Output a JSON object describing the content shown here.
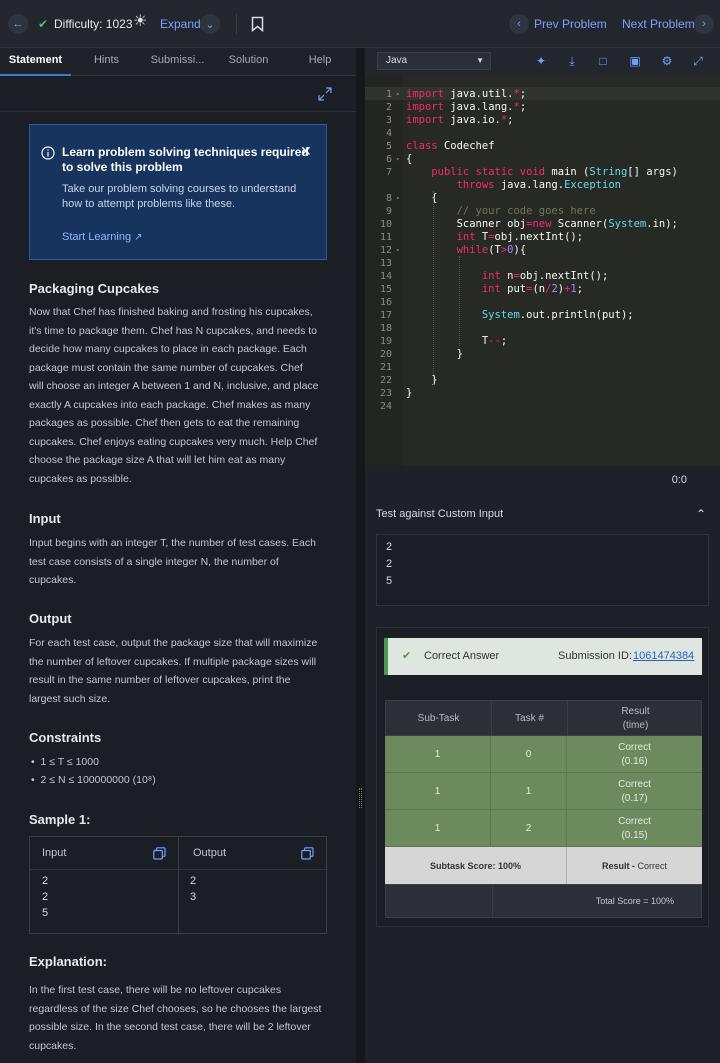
{
  "topbar": {
    "difficulty": "Difficulty: 1023",
    "expand": "Expand",
    "prev": "Prev Problem",
    "next": "Next Problem"
  },
  "tabs": [
    "Statement",
    "Hints",
    "Submissi...",
    "Solution",
    "Help"
  ],
  "callout": {
    "title": "Learn problem solving techniques required to solve this problem",
    "body": "Take our problem solving courses to understand how to attempt problems like these.",
    "link": "Start Learning"
  },
  "problem": {
    "title": "Packaging Cupcakes",
    "statement_lines": [
      "Now that Chef has finished baking and frosting his cupcakes,",
      "it's time to package them. Chef has N cupcakes, and needs to",
      "decide how many cupcakes to place in each package. Each",
      "package must contain the same number of cupcakes. Chef",
      "will choose an integer A between 1 and N, inclusive, and place",
      "exactly A cupcakes into each package. Chef makes as many",
      "packages as possible. Chef then gets to eat the remaining",
      "cupcakes. Chef enjoys eating cupcakes very much. Help Chef",
      "choose the package size A that will let him eat as many",
      "cupcakes as possible."
    ],
    "input_title": "Input",
    "input_lines": [
      "Input begins with an integer T, the number of test cases. Each",
      "test case consists of a single integer N, the number of",
      "cupcakes."
    ],
    "output_title": "Output",
    "output_lines": [
      "For each test case, output the package size that will maximize",
      "the number of leftover cupcakes. If multiple package sizes will",
      "result in the same number of leftover cupcakes, print the",
      "largest such size."
    ],
    "constraints_title": "Constraints",
    "constraints": [
      "1 ≤ T ≤ 1000",
      "2 ≤ N ≤ 100000000 (10⁸)"
    ],
    "sample_title": "Sample 1:",
    "sample_input_label": "Input",
    "sample_output_label": "Output",
    "sample_input": [
      "2",
      "2",
      "5"
    ],
    "sample_output": [
      "2",
      "3"
    ],
    "explanation_title": "Explanation:",
    "explanation_lines": [
      "In the first test case, there will be no leftover cupcakes",
      "regardless of the size Chef chooses, so he chooses the largest",
      "possible size. In the second test case, there will be 2 leftover",
      "cupcakes."
    ]
  },
  "editor": {
    "language": "Java",
    "cursor": "0:0"
  },
  "custom_input": {
    "title": "Test against Custom Input",
    "lines": [
      "2",
      "2",
      "5"
    ]
  },
  "result": {
    "status": "Correct Answer",
    "submission_label": "Submission ID:",
    "submission_id": "1061474384",
    "headers": [
      "Sub-Task",
      "Task #",
      "Result",
      "(time)"
    ],
    "rows": [
      {
        "subtask": "1",
        "task": "0",
        "result": "Correct",
        "time": "(0.16)"
      },
      {
        "subtask": "1",
        "task": "1",
        "result": "Correct",
        "time": "(0.17)"
      },
      {
        "subtask": "1",
        "task": "2",
        "result": "Correct",
        "time": "(0.15)"
      }
    ],
    "subtask_score": "Subtask Score: 100%",
    "result_label": "Result -",
    "result_value": "Correct",
    "total_score": "Total Score = 100%"
  }
}
